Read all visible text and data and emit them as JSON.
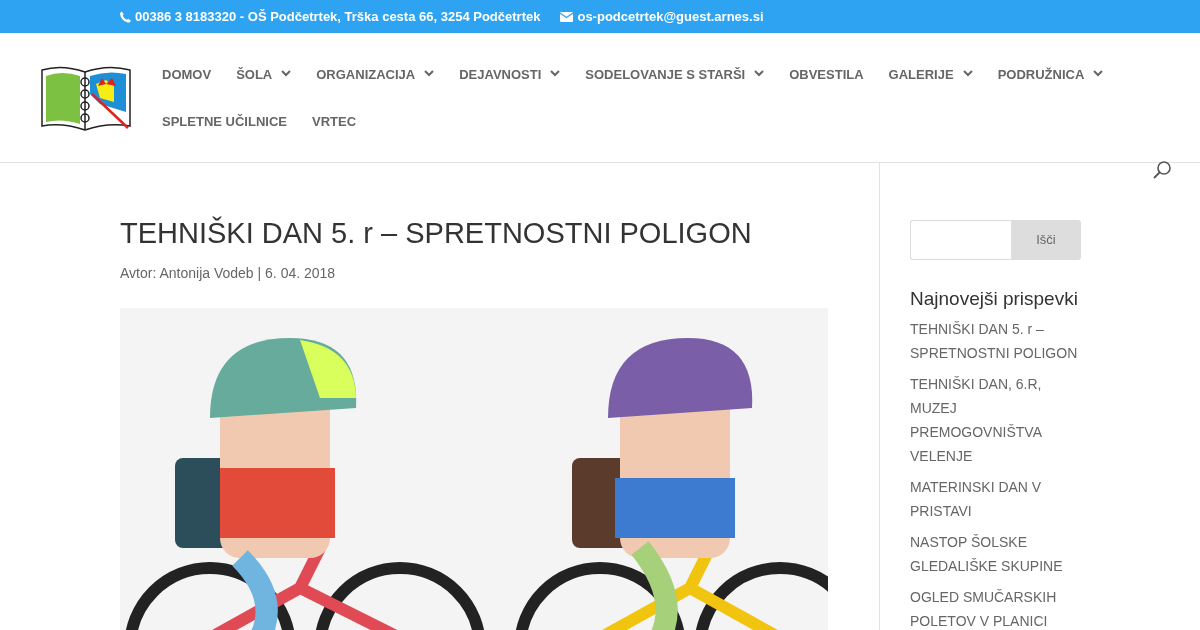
{
  "top_bar": {
    "phone": "00386 3 8183320 - OŠ Podčetrtek, Trška cesta 66, 3254 Podčetrtek",
    "email": "os-podcetrtek@guest.arnes.si"
  },
  "nav": [
    {
      "label": "DOMOV",
      "dropdown": false
    },
    {
      "label": "ŠOLA",
      "dropdown": true
    },
    {
      "label": "ORGANIZACIJA",
      "dropdown": true
    },
    {
      "label": "DEJAVNOSTI",
      "dropdown": true
    },
    {
      "label": "SODELOVANJE S STARŠI",
      "dropdown": true
    },
    {
      "label": "OBVESTILA",
      "dropdown": false
    },
    {
      "label": "GALERIJE",
      "dropdown": true
    },
    {
      "label": "PODRUŽNICA",
      "dropdown": true
    },
    {
      "label": "SPLETNE UČILNICE",
      "dropdown": false
    },
    {
      "label": "VRTEC",
      "dropdown": false
    }
  ],
  "post": {
    "title": "TEHNIŠKI DAN 5. r – SPRETNOSTNI POLIGON",
    "meta_prefix": "Avtor:",
    "author": "Antonija Vodeb",
    "separator": "|",
    "date": "6. 04. 2018"
  },
  "sidebar": {
    "search_button": "Išči",
    "recent_title": "Najnovejši prispevki",
    "recent_posts": [
      "TEHNIŠKI DAN 5. r – SPRETNOSTNI POLIGON",
      "TEHNIŠKI DAN, 6.R, MUZEJ PREMOGOVNIŠTVA VELENJE",
      "MATERINSKI DAN V PRISTAVI",
      "NASTOP ŠOLSKE GLEDALIŠKE SKUPINE",
      "OGLED SMUČARSKIH POLETOV V PLANICI"
    ]
  }
}
